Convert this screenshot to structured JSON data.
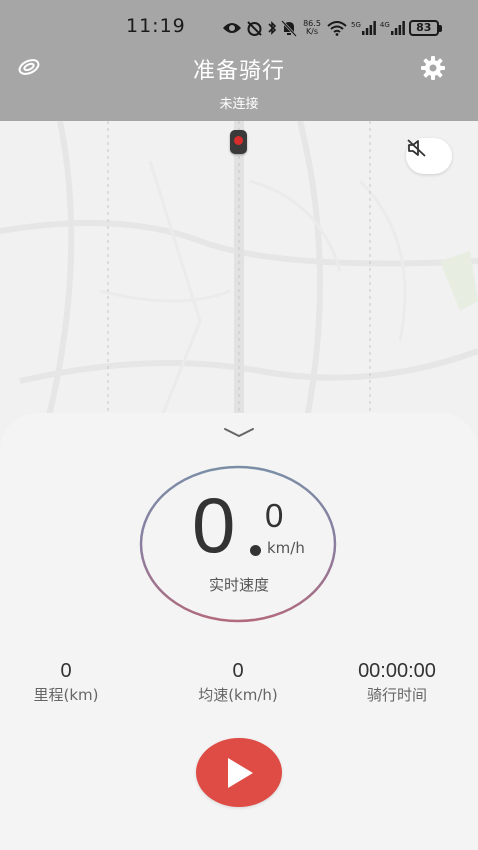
{
  "status_bar": {
    "time": "11:19",
    "net_speed_value": "86.5",
    "net_speed_unit": "K/s",
    "signal_1_label": "5G",
    "signal_2_label": "4G",
    "battery_level": "83"
  },
  "header": {
    "title": "准备骑行",
    "subtitle": "未连接",
    "background_color": "#a6a6a6"
  },
  "map": {
    "mute_icon": "speaker-muted-icon",
    "marker_color": "#d92c2c"
  },
  "speed": {
    "integer": "0",
    "decimal": "0",
    "unit": "km/h",
    "label": "实时速度"
  },
  "stats": {
    "distance": {
      "value": "0",
      "label": "里程(km)"
    },
    "avg_speed": {
      "value": "0",
      "label": "均速(km/h)"
    },
    "ride_time": {
      "value": "00:00:00",
      "label": "骑行时间"
    }
  },
  "start_button": {
    "icon": "play-icon",
    "color": "#de4c45"
  }
}
